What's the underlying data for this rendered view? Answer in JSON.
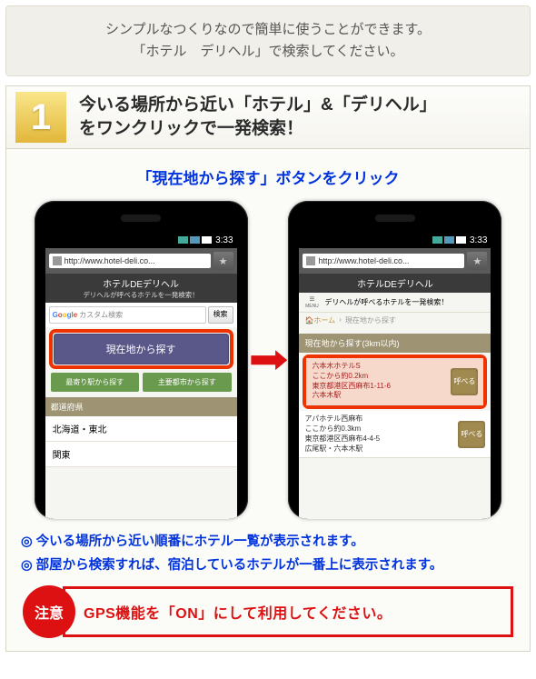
{
  "intro": {
    "line1": "シンプルなつくりなので簡単に使うことができます。",
    "line2": "「ホテル　デリヘル」で検索してください。"
  },
  "step": {
    "number": "1",
    "title_l1": "今いる場所から近い「ホテル」&「デリヘル」",
    "title_l2": "をワンクリックで一発検索！"
  },
  "blue_heading": "「現在地から探す」ボタンをクリック",
  "phone_common": {
    "time": "3:33",
    "url": "http://www.hotel-deli.co...",
    "site_title": "ホテルDEデリヘル"
  },
  "phone1": {
    "site_sub": "デリヘルが呼べるホテルを一発検索！",
    "search_placeholder": "カスタム検索",
    "search_btn": "検索",
    "main_btn": "現在地から探す",
    "btn_a": "最寄り駅から探す",
    "btn_b": "主要都市から探す",
    "section": "都道府県",
    "list": [
      "北海道・東北",
      "関東"
    ]
  },
  "phone2": {
    "menu_label": "MENU",
    "tagline": "デリヘルが呼べるホテルを一発検索！",
    "home": "ホーム",
    "crumb_cur": "現在地から探す",
    "section": "現在地から探す(3km以内)",
    "call_label": "呼べる",
    "results": [
      {
        "name": "六本木ホテルS",
        "dist": "ここから約0.2km",
        "addr": "東京都港区西麻布1-11-6",
        "sta": "六本木駅"
      },
      {
        "name": "アパホテル西麻布",
        "dist": "ここから約0.3km",
        "addr": "東京都港区西麻布4-4-5",
        "sta": "広尾駅・六本木駅"
      }
    ]
  },
  "bullets": [
    "今いる場所から近い順番にホテル一覧が表示されます。",
    "部屋から検索すれば、宿泊しているホテルが一番上に表示されます。"
  ],
  "alert": {
    "badge": "注意",
    "text": "GPS機能を「ON」にして利用してください。"
  }
}
